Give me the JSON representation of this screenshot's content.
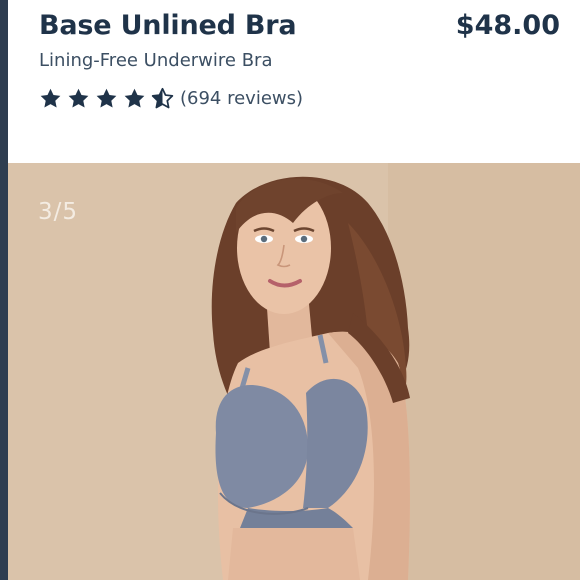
{
  "product": {
    "title": "Base Unlined Bra",
    "price": "$48.00",
    "subtitle": "Lining-Free Underwire Bra",
    "rating": 4.5,
    "reviews_label": "(694 reviews)"
  },
  "gallery": {
    "counter": "3/5",
    "current_index": 3,
    "total": 5
  },
  "colors": {
    "accent": "#1f3349",
    "rail": "#2e3d50",
    "photo_background": "#d8c0a6",
    "garment": "#7f8aa3"
  },
  "icons": {
    "star_full": "star-icon",
    "star_half": "star-half-icon"
  }
}
